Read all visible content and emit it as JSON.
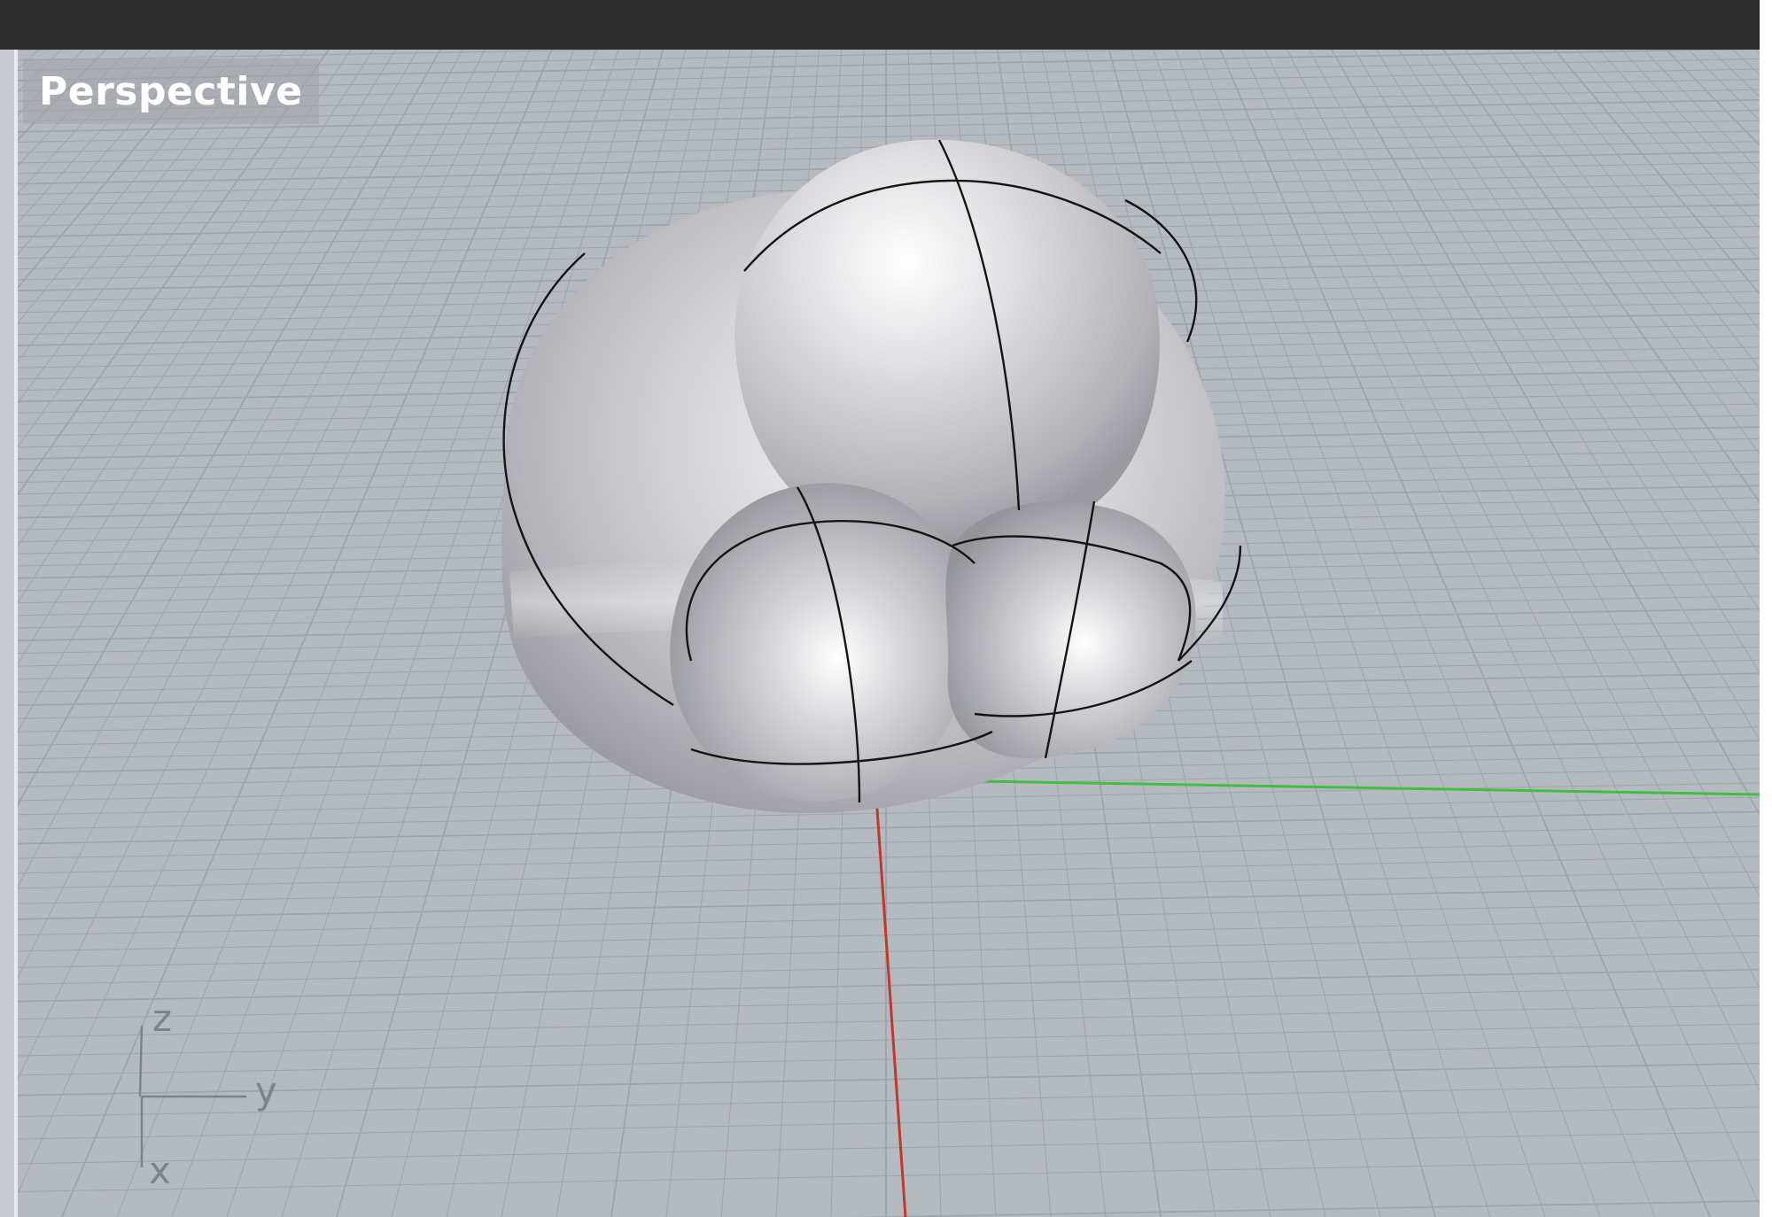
{
  "viewport": {
    "name": "Perspective"
  },
  "axis_widget": {
    "z_label": "z",
    "y_label": "y",
    "x_label": "x"
  },
  "world_axes": {
    "x_axis_color": "#c0392b",
    "y_axis_color": "#3fbf3f"
  },
  "colors": {
    "title_bar": "#2b2b2b",
    "viewport_background": "#b5bac0",
    "grid_line": "#9ea4ab",
    "surface": "#c8c8cc",
    "isocurve": "#141414"
  }
}
